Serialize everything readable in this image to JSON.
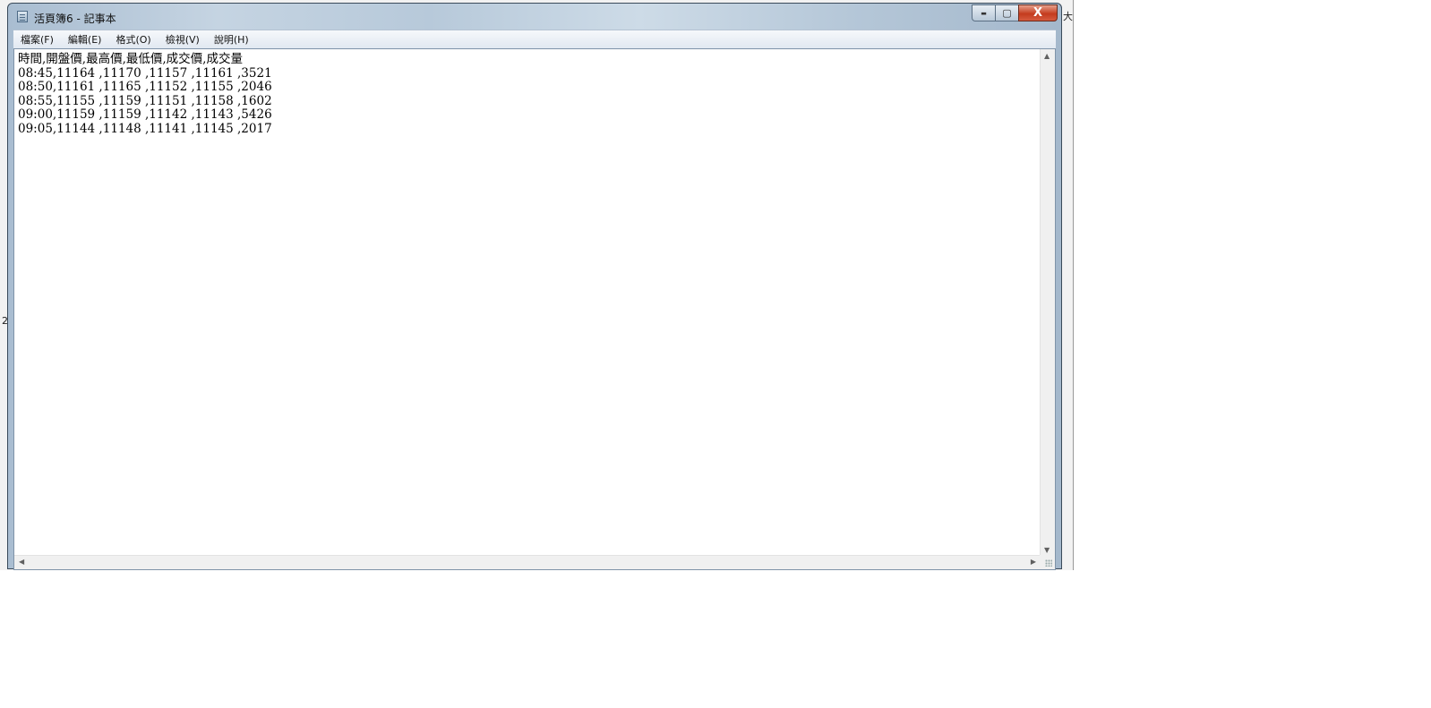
{
  "window": {
    "title": "活頁簿6 - 記事本",
    "buttons": {
      "minimize": "▬",
      "maximize": "▢",
      "close": "X"
    }
  },
  "menu": [
    "檔案(F)",
    "編輯(E)",
    "格式(O)",
    "檢視(V)",
    "說明(H)"
  ],
  "document": {
    "lines": [
      "時間,開盤價,最高價,最低價,成交價,成交量",
      "08:45,11164 ,11170 ,11157 ,11161 ,3521",
      "08:50,11161 ,11165 ,11152 ,11155 ,2046",
      "08:55,11155 ,11159 ,11151 ,11158 ,1602",
      "09:00,11159 ,11159 ,11142 ,11143 ,5426",
      "09:05,11144 ,11148 ,11141 ,11145 ,2017"
    ]
  },
  "background": {
    "fragment_right": "大",
    "fragment_left": "2"
  },
  "scroll": {
    "up": "▲",
    "down": "▼",
    "left": "◀",
    "right": "▶"
  }
}
